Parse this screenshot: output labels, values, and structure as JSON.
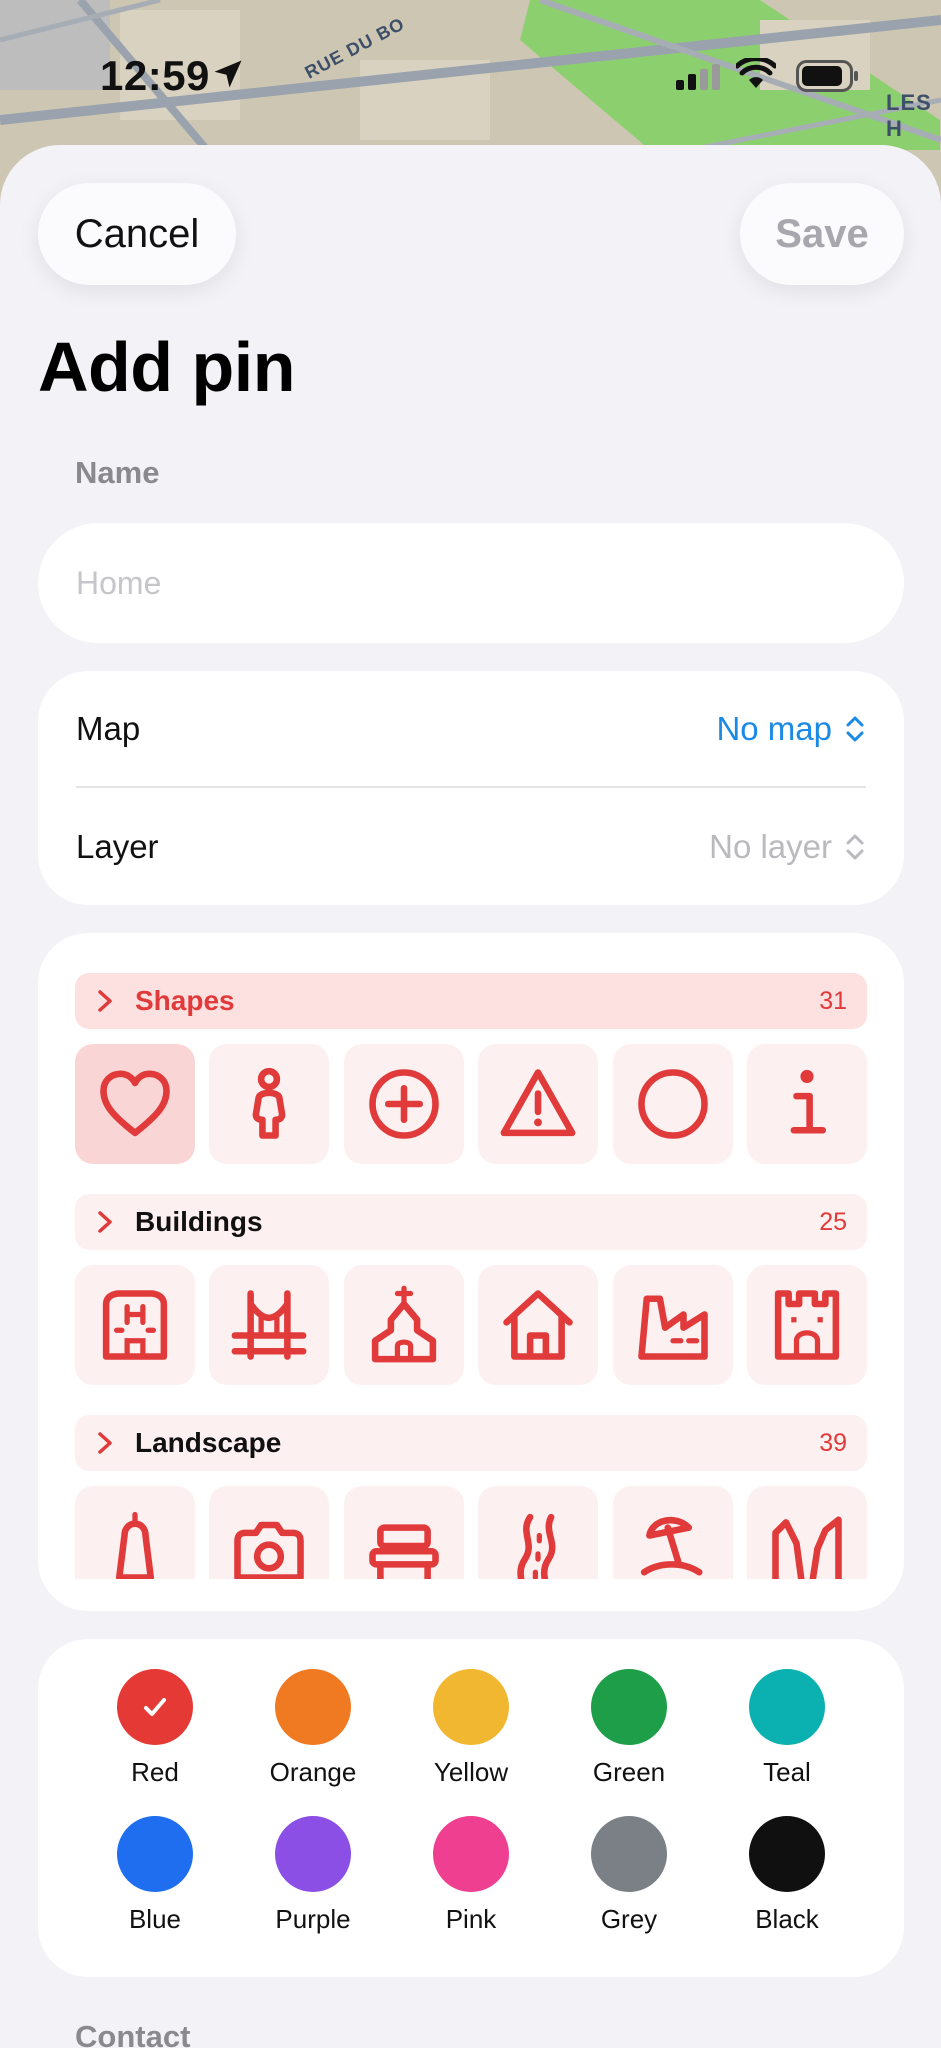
{
  "status": {
    "time": "12:59"
  },
  "map": {
    "street_label": "RUE DU BO",
    "area_label": "LES H"
  },
  "toolbar": {
    "cancel_label": "Cancel",
    "save_label": "Save"
  },
  "page": {
    "title": "Add pin"
  },
  "name_field": {
    "label": "Name",
    "placeholder": "Home",
    "value": ""
  },
  "map_settings": {
    "map_label": "Map",
    "map_value": "No map",
    "layer_label": "Layer",
    "layer_value": "No layer"
  },
  "icon_categories": [
    {
      "name": "Shapes",
      "count": "31",
      "icons": [
        "heart-icon",
        "person-icon",
        "plus-circle-icon",
        "warning-triangle-icon",
        "circle-icon",
        "info-icon"
      ],
      "selected": "heart-icon"
    },
    {
      "name": "Buildings",
      "count": "25",
      "icons": [
        "hotel-icon",
        "bridge-icon",
        "church-icon",
        "house-icon",
        "factory-icon",
        "castle-icon"
      ]
    },
    {
      "name": "Landscape",
      "count": "39",
      "icons": [
        "lighthouse-icon",
        "camera-icon",
        "bench-icon",
        "road-icon",
        "beach-icon",
        "canyon-icon"
      ]
    }
  ],
  "colors": [
    {
      "name": "Red",
      "hex": "#e53935",
      "selected": true
    },
    {
      "name": "Orange",
      "hex": "#f07a22"
    },
    {
      "name": "Yellow",
      "hex": "#f2b731"
    },
    {
      "name": "Green",
      "hex": "#1f9e4a"
    },
    {
      "name": "Teal",
      "hex": "#0bb1b0"
    },
    {
      "name": "Blue",
      "hex": "#1f6ef0"
    },
    {
      "name": "Purple",
      "hex": "#8b4fe6"
    },
    {
      "name": "Pink",
      "hex": "#ef3f91"
    },
    {
      "name": "Grey",
      "hex": "#7b8087"
    },
    {
      "name": "Black",
      "hex": "#101010"
    }
  ],
  "contact": {
    "label": "Contact"
  },
  "theme": {
    "accent": "#e03a3a",
    "link": "#1a8ae6"
  }
}
